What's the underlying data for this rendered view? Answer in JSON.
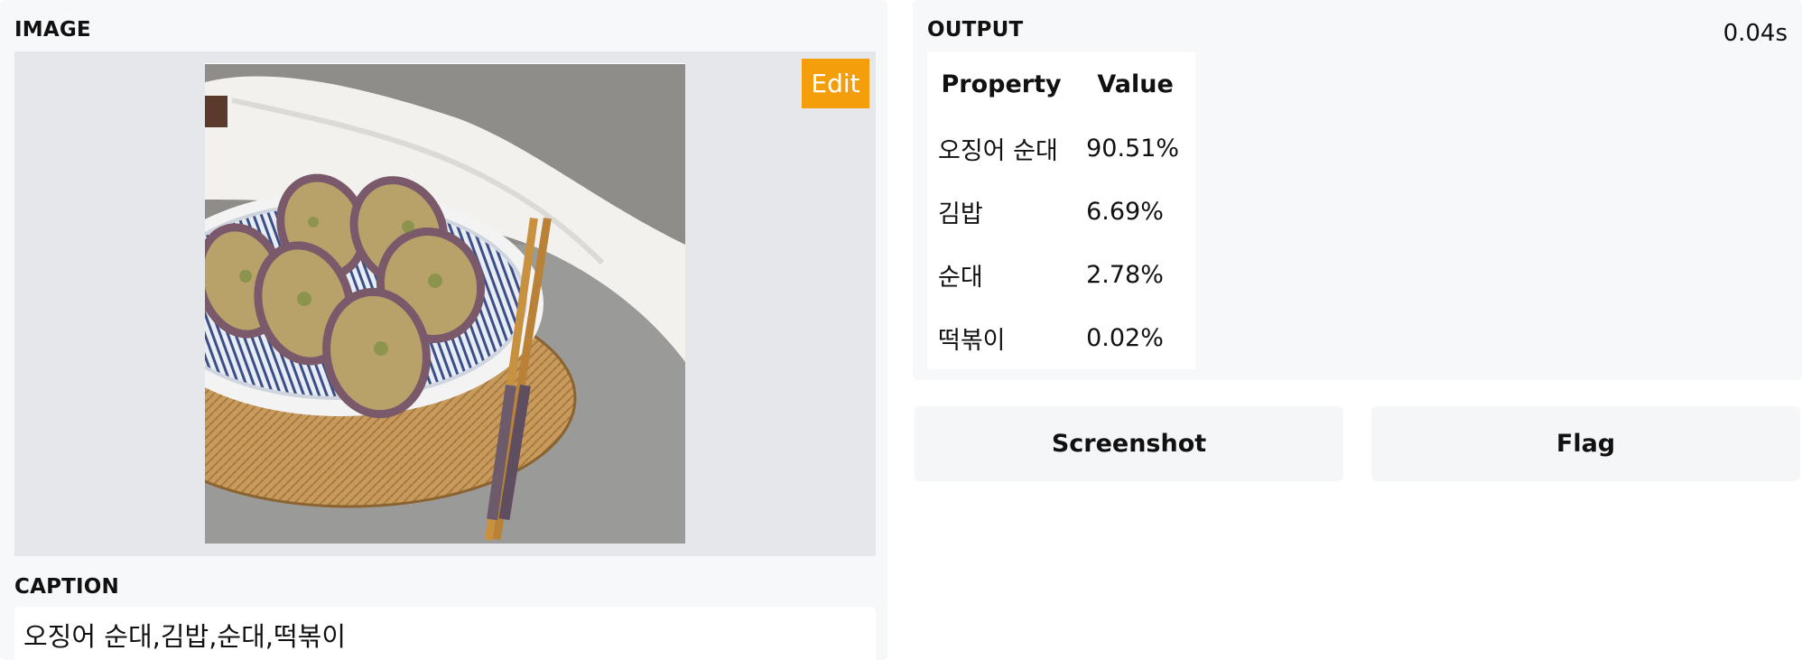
{
  "image_section": {
    "label": "IMAGE",
    "edit_label": "Edit"
  },
  "caption_section": {
    "label": "CAPTION",
    "text": "오징어 순대,김밥,순대,떡볶이"
  },
  "output_section": {
    "label": "OUTPUT",
    "time": "0.04s",
    "table": {
      "headers": [
        "Property",
        "Value"
      ],
      "rows": [
        {
          "property": "오징어 순대",
          "value": "90.51%"
        },
        {
          "property": "김밥",
          "value": "6.69%"
        },
        {
          "property": "순대",
          "value": "2.78%"
        },
        {
          "property": "떡볶이",
          "value": "0.02%"
        }
      ]
    }
  },
  "actions": {
    "screenshot_label": "Screenshot",
    "flag_label": "Flag"
  },
  "colors": {
    "accent": "#f59e0b",
    "panel_bg": "#f7f8fa",
    "image_bg": "#e5e7eb"
  }
}
